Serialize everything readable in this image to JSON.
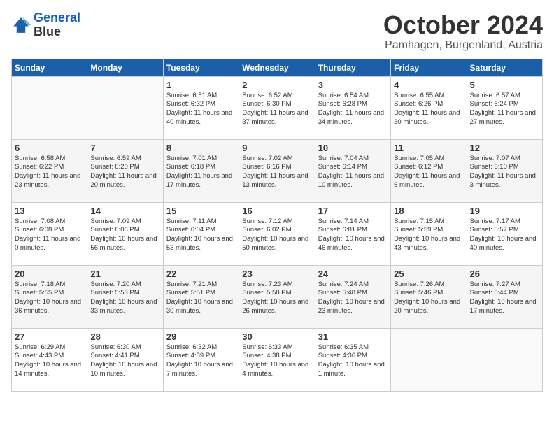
{
  "header": {
    "logo_line1": "General",
    "logo_line2": "Blue",
    "month": "October 2024",
    "location": "Pamhagen, Burgenland, Austria"
  },
  "weekdays": [
    "Sunday",
    "Monday",
    "Tuesday",
    "Wednesday",
    "Thursday",
    "Friday",
    "Saturday"
  ],
  "weeks": [
    [
      {
        "day": "",
        "info": ""
      },
      {
        "day": "",
        "info": ""
      },
      {
        "day": "1",
        "info": "Sunrise: 6:51 AM\nSunset: 6:32 PM\nDaylight: 11 hours and 40 minutes."
      },
      {
        "day": "2",
        "info": "Sunrise: 6:52 AM\nSunset: 6:30 PM\nDaylight: 11 hours and 37 minutes."
      },
      {
        "day": "3",
        "info": "Sunrise: 6:54 AM\nSunset: 6:28 PM\nDaylight: 11 hours and 34 minutes."
      },
      {
        "day": "4",
        "info": "Sunrise: 6:55 AM\nSunset: 6:26 PM\nDaylight: 11 hours and 30 minutes."
      },
      {
        "day": "5",
        "info": "Sunrise: 6:57 AM\nSunset: 6:24 PM\nDaylight: 11 hours and 27 minutes."
      }
    ],
    [
      {
        "day": "6",
        "info": "Sunrise: 6:58 AM\nSunset: 6:22 PM\nDaylight: 11 hours and 23 minutes."
      },
      {
        "day": "7",
        "info": "Sunrise: 6:59 AM\nSunset: 6:20 PM\nDaylight: 11 hours and 20 minutes."
      },
      {
        "day": "8",
        "info": "Sunrise: 7:01 AM\nSunset: 6:18 PM\nDaylight: 11 hours and 17 minutes."
      },
      {
        "day": "9",
        "info": "Sunrise: 7:02 AM\nSunset: 6:16 PM\nDaylight: 11 hours and 13 minutes."
      },
      {
        "day": "10",
        "info": "Sunrise: 7:04 AM\nSunset: 6:14 PM\nDaylight: 11 hours and 10 minutes."
      },
      {
        "day": "11",
        "info": "Sunrise: 7:05 AM\nSunset: 6:12 PM\nDaylight: 11 hours and 6 minutes."
      },
      {
        "day": "12",
        "info": "Sunrise: 7:07 AM\nSunset: 6:10 PM\nDaylight: 11 hours and 3 minutes."
      }
    ],
    [
      {
        "day": "13",
        "info": "Sunrise: 7:08 AM\nSunset: 6:08 PM\nDaylight: 11 hours and 0 minutes."
      },
      {
        "day": "14",
        "info": "Sunrise: 7:09 AM\nSunset: 6:06 PM\nDaylight: 10 hours and 56 minutes."
      },
      {
        "day": "15",
        "info": "Sunrise: 7:11 AM\nSunset: 6:04 PM\nDaylight: 10 hours and 53 minutes."
      },
      {
        "day": "16",
        "info": "Sunrise: 7:12 AM\nSunset: 6:02 PM\nDaylight: 10 hours and 50 minutes."
      },
      {
        "day": "17",
        "info": "Sunrise: 7:14 AM\nSunset: 6:01 PM\nDaylight: 10 hours and 46 minutes."
      },
      {
        "day": "18",
        "info": "Sunrise: 7:15 AM\nSunset: 5:59 PM\nDaylight: 10 hours and 43 minutes."
      },
      {
        "day": "19",
        "info": "Sunrise: 7:17 AM\nSunset: 5:57 PM\nDaylight: 10 hours and 40 minutes."
      }
    ],
    [
      {
        "day": "20",
        "info": "Sunrise: 7:18 AM\nSunset: 5:55 PM\nDaylight: 10 hours and 36 minutes."
      },
      {
        "day": "21",
        "info": "Sunrise: 7:20 AM\nSunset: 5:53 PM\nDaylight: 10 hours and 33 minutes."
      },
      {
        "day": "22",
        "info": "Sunrise: 7:21 AM\nSunset: 5:51 PM\nDaylight: 10 hours and 30 minutes."
      },
      {
        "day": "23",
        "info": "Sunrise: 7:23 AM\nSunset: 5:50 PM\nDaylight: 10 hours and 26 minutes."
      },
      {
        "day": "24",
        "info": "Sunrise: 7:24 AM\nSunset: 5:48 PM\nDaylight: 10 hours and 23 minutes."
      },
      {
        "day": "25",
        "info": "Sunrise: 7:26 AM\nSunset: 5:46 PM\nDaylight: 10 hours and 20 minutes."
      },
      {
        "day": "26",
        "info": "Sunrise: 7:27 AM\nSunset: 5:44 PM\nDaylight: 10 hours and 17 minutes."
      }
    ],
    [
      {
        "day": "27",
        "info": "Sunrise: 6:29 AM\nSunset: 4:43 PM\nDaylight: 10 hours and 14 minutes."
      },
      {
        "day": "28",
        "info": "Sunrise: 6:30 AM\nSunset: 4:41 PM\nDaylight: 10 hours and 10 minutes."
      },
      {
        "day": "29",
        "info": "Sunrise: 6:32 AM\nSunset: 4:39 PM\nDaylight: 10 hours and 7 minutes."
      },
      {
        "day": "30",
        "info": "Sunrise: 6:33 AM\nSunset: 4:38 PM\nDaylight: 10 hours and 4 minutes."
      },
      {
        "day": "31",
        "info": "Sunrise: 6:35 AM\nSunset: 4:36 PM\nDaylight: 10 hours and 1 minute."
      },
      {
        "day": "",
        "info": ""
      },
      {
        "day": "",
        "info": ""
      }
    ]
  ]
}
